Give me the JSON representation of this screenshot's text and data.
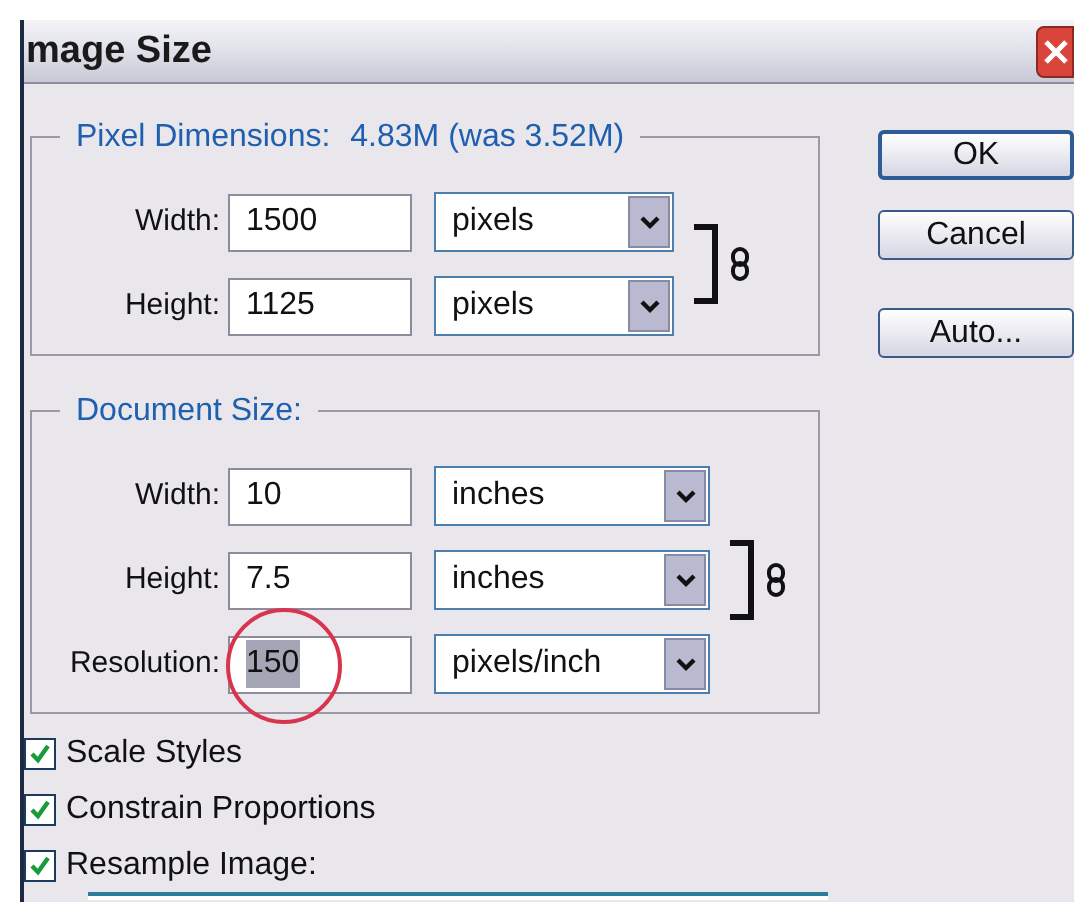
{
  "window": {
    "title": "mage Size"
  },
  "pixel_dimensions": {
    "legend": "Pixel Dimensions:",
    "size": "4.83M (was 3.52M)",
    "constrained": true,
    "fields": [
      {
        "label": "Width:",
        "value": "1500",
        "unit": "pixels"
      },
      {
        "label": "Height:",
        "value": "1125",
        "unit": "pixels"
      }
    ]
  },
  "document_size": {
    "legend": "Document Size:",
    "constrained": true,
    "fields": [
      {
        "label": "Width:",
        "value": "10",
        "unit": "inches",
        "text_selected": false,
        "circled": false
      },
      {
        "label": "Height:",
        "value": "7.5",
        "unit": "inches",
        "text_selected": false,
        "circled": false
      },
      {
        "label": "Resolution:",
        "value": "150",
        "unit": "pixels/inch",
        "text_selected": true,
        "circled": true
      }
    ]
  },
  "buttons": [
    {
      "label": "OK",
      "default": true
    },
    {
      "label": "Cancel",
      "default": false
    },
    {
      "label": "Auto...",
      "default": false
    }
  ],
  "checkboxes": [
    {
      "label": "Scale Styles",
      "checked": true
    },
    {
      "label": "Constrain Proportions",
      "checked": true
    },
    {
      "label": "Resample Image:",
      "checked": true
    }
  ]
}
